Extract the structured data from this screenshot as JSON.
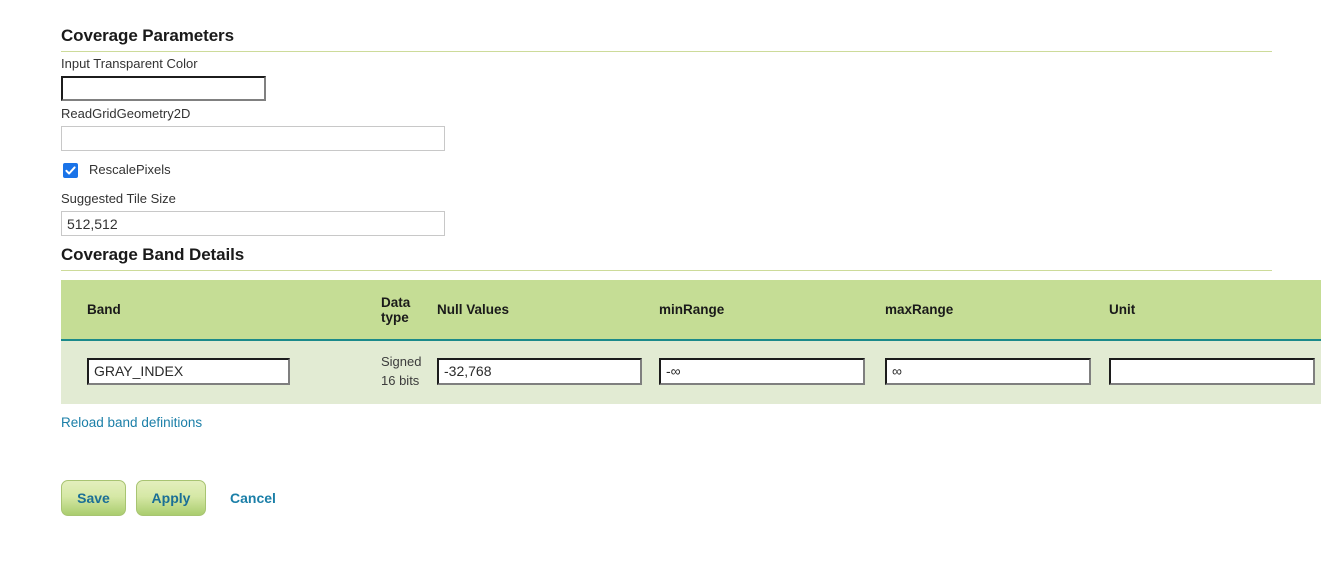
{
  "coverage_parameters": {
    "heading": "Coverage Parameters",
    "input_transparent_color": {
      "label": "Input Transparent Color",
      "value": "",
      "placeholder": ""
    },
    "read_grid_geometry_2d": {
      "label": "ReadGridGeometry2D",
      "value": "",
      "placeholder": ""
    },
    "rescale_pixels": {
      "label": "RescalePixels",
      "checked": true
    },
    "suggested_tile_size": {
      "label": "Suggested Tile Size",
      "value": "512,512",
      "placeholder": ""
    }
  },
  "coverage_band_details": {
    "heading": "Coverage Band Details",
    "columns": [
      "Band",
      "Data type",
      "Null Values",
      "minRange",
      "maxRange",
      "Unit"
    ],
    "rows": [
      {
        "band": "GRAY_INDEX",
        "data_type": "Signed 16 bits",
        "data_type_line1": "Signed",
        "data_type_line2": "16 bits",
        "null_values": "-32,768",
        "min_range": "-∞",
        "max_range": "∞",
        "unit": ""
      }
    ],
    "reload_link": "Reload band definitions"
  },
  "actions": {
    "save_label": "Save",
    "apply_label": "Apply",
    "cancel_label": "Cancel"
  },
  "colors": {
    "table_header_bg": "#c5dd95",
    "table_row_bg": "#e2ebd3",
    "table_divider": "#1b8a8a",
    "heading_rule": "#cddb9a",
    "link": "#1b7fa8",
    "checkbox": "#1a73e8",
    "button_text": "#1b6f96"
  },
  "icons": {
    "checkmark": "check-icon"
  }
}
